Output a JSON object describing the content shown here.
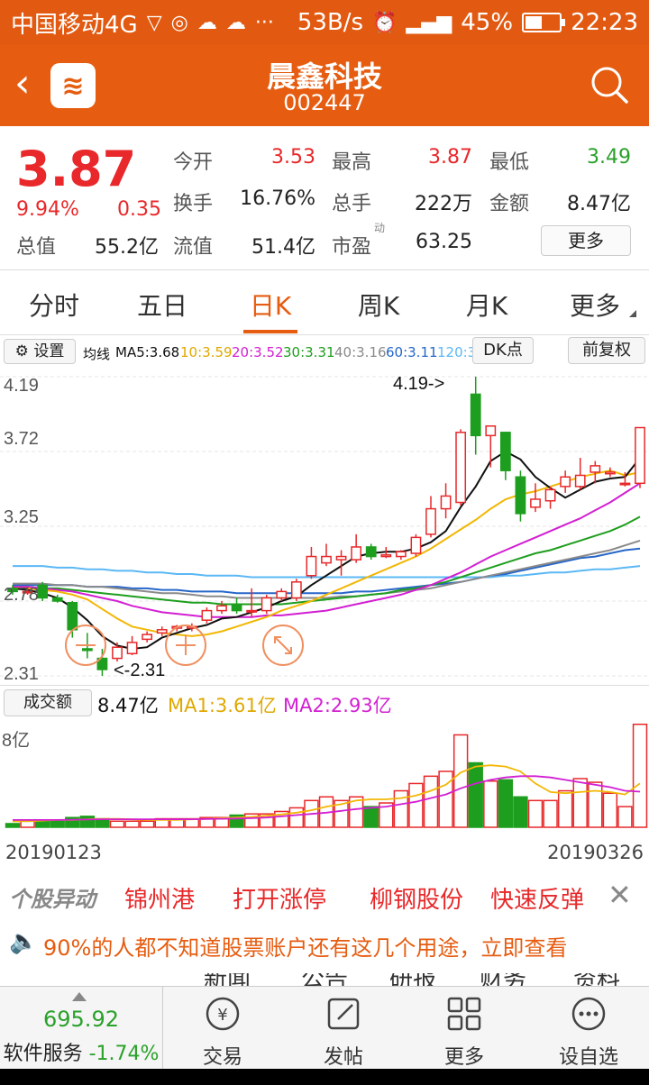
{
  "status_bar": {
    "carrier": "中国移动4G",
    "speed": "53B/s",
    "battery": "45%",
    "time": "22:23"
  },
  "header": {
    "name": "晨鑫科技",
    "code": "002447"
  },
  "quote": {
    "price": "3.87",
    "change_pct": "9.94%",
    "change": "0.35",
    "open_label": "今开",
    "open": "3.53",
    "high_label": "最高",
    "high": "3.87",
    "low_label": "最低",
    "low": "3.49",
    "turnover_label": "换手",
    "turnover": "16.76%",
    "volume_label": "总手",
    "volume": "222万",
    "amount_label": "金额",
    "amount": "8.47亿",
    "mcap_label": "总值",
    "mcap": "55.2亿",
    "float_label": "流值",
    "float": "51.4亿",
    "pe_label": "市盈",
    "pe_sup": "动",
    "pe": "63.25",
    "more": "更多"
  },
  "tabs": [
    "分时",
    "五日",
    "日K",
    "周K",
    "月K",
    "更多"
  ],
  "active_tab": 2,
  "ma_bar": {
    "settings": "设置",
    "label": "均线",
    "ma5": "MA5:3.68",
    "ma10": "10:3.59",
    "ma20": "20:3.52",
    "ma30": "30:3.31",
    "ma40": "40:3.16",
    "ma60": "60:3.11",
    "ma120": "120:3",
    "dk": "DK点",
    "adjust": "前复权"
  },
  "colors": {
    "up": "#e8282a",
    "down": "#1e9e1e",
    "ma5": "#111111",
    "ma10": "#f2b705",
    "ma20": "#d21fd2",
    "ma30": "#1e9e1e",
    "ma40": "#8a8a8a",
    "ma60": "#2767c9",
    "ma120": "#5bb8f5"
  },
  "chart_labels": {
    "y_ticks": [
      "4.19",
      "3.72",
      "3.25",
      "2.78",
      "2.31"
    ],
    "max_marker": "4.19->",
    "min_marker": "<-2.31"
  },
  "volume_bar": {
    "label": "成交额",
    "value": "8.47亿",
    "ma1": "MA1:3.61亿",
    "ma2": "MA2:2.93亿",
    "y_tick": "8亿"
  },
  "dates": {
    "start": "20190123",
    "end": "20190326"
  },
  "news": {
    "logo": "个股异动",
    "items": [
      "锦州港",
      "打开涨停",
      "柳钢股份",
      "快速反弹"
    ]
  },
  "ad": {
    "text": "90%的人都不知道股票账户还有这几个用途，立即查看"
  },
  "subtabs": [
    "新闻",
    "公告",
    "研报",
    "财务",
    "资料"
  ],
  "bottom": {
    "index_value": "695.92",
    "index_name": "软件服务",
    "index_change": "-1.74%",
    "nav": [
      "交易",
      "发帖",
      "更多",
      "设自选"
    ]
  },
  "chart_data": {
    "type": "candlestick",
    "y_range": [
      2.31,
      4.19
    ],
    "x_range": [
      "20190123",
      "20190326"
    ],
    "candles": [
      {
        "o": 2.86,
        "c": 2.84,
        "h": 2.88,
        "l": 2.82
      },
      {
        "o": 2.84,
        "c": 2.84,
        "h": 2.87,
        "l": 2.82
      },
      {
        "o": 2.88,
        "c": 2.8,
        "h": 2.9,
        "l": 2.78
      },
      {
        "o": 2.8,
        "c": 2.78,
        "h": 2.82,
        "l": 2.77
      },
      {
        "o": 2.77,
        "c": 2.6,
        "h": 2.78,
        "l": 2.55
      },
      {
        "o": 2.48,
        "c": 2.47,
        "h": 2.58,
        "l": 2.42
      },
      {
        "o": 2.42,
        "c": 2.35,
        "h": 2.48,
        "l": 2.31
      },
      {
        "o": 2.42,
        "c": 2.49,
        "h": 2.52,
        "l": 2.4
      },
      {
        "o": 2.45,
        "c": 2.52,
        "h": 2.56,
        "l": 2.44
      },
      {
        "o": 2.54,
        "c": 2.57,
        "h": 2.59,
        "l": 2.52
      },
      {
        "o": 2.58,
        "c": 2.6,
        "h": 2.62,
        "l": 2.56
      },
      {
        "o": 2.61,
        "c": 2.62,
        "h": 2.63,
        "l": 2.59
      },
      {
        "o": 2.61,
        "c": 2.62,
        "h": 2.64,
        "l": 2.59
      },
      {
        "o": 2.66,
        "c": 2.72,
        "h": 2.74,
        "l": 2.64
      },
      {
        "o": 2.72,
        "c": 2.75,
        "h": 2.78,
        "l": 2.7
      },
      {
        "o": 2.76,
        "c": 2.72,
        "h": 2.8,
        "l": 2.7
      },
      {
        "o": 2.72,
        "c": 2.72,
        "h": 2.86,
        "l": 2.68
      },
      {
        "o": 2.72,
        "c": 2.8,
        "h": 2.82,
        "l": 2.7
      },
      {
        "o": 2.8,
        "c": 2.84,
        "h": 2.86,
        "l": 2.78
      },
      {
        "o": 2.8,
        "c": 2.9,
        "h": 2.92,
        "l": 2.78
      },
      {
        "o": 2.94,
        "c": 3.06,
        "h": 3.12,
        "l": 2.92
      },
      {
        "o": 3.02,
        "c": 3.06,
        "h": 3.14,
        "l": 3.0
      },
      {
        "o": 3.04,
        "c": 3.06,
        "h": 3.1,
        "l": 2.94
      },
      {
        "o": 3.04,
        "c": 3.12,
        "h": 3.2,
        "l": 3.02
      },
      {
        "o": 3.12,
        "c": 3.06,
        "h": 3.14,
        "l": 3.04
      },
      {
        "o": 3.06,
        "c": 3.07,
        "h": 3.12,
        "l": 3.05
      },
      {
        "o": 3.06,
        "c": 3.09,
        "h": 3.1,
        "l": 3.04
      },
      {
        "o": 3.08,
        "c": 3.18,
        "h": 3.2,
        "l": 3.06
      },
      {
        "o": 3.2,
        "c": 3.36,
        "h": 3.44,
        "l": 3.18
      },
      {
        "o": 3.36,
        "c": 3.44,
        "h": 3.52,
        "l": 3.3
      },
      {
        "o": 3.4,
        "c": 3.84,
        "h": 3.86,
        "l": 3.38
      },
      {
        "o": 4.08,
        "c": 3.82,
        "h": 4.19,
        "l": 3.7
      },
      {
        "o": 3.82,
        "c": 3.88,
        "h": 3.86,
        "l": 3.62
      },
      {
        "o": 3.84,
        "c": 3.6,
        "h": 3.84,
        "l": 3.54
      },
      {
        "o": 3.56,
        "c": 3.33,
        "h": 3.6,
        "l": 3.28
      },
      {
        "o": 3.37,
        "c": 3.42,
        "h": 3.52,
        "l": 3.34
      },
      {
        "o": 3.41,
        "c": 3.48,
        "h": 3.5,
        "l": 3.36
      },
      {
        "o": 3.5,
        "c": 3.56,
        "h": 3.6,
        "l": 3.46
      },
      {
        "o": 3.5,
        "c": 3.57,
        "h": 3.68,
        "l": 3.48
      },
      {
        "o": 3.59,
        "c": 3.63,
        "h": 3.66,
        "l": 3.52
      },
      {
        "o": 3.58,
        "c": 3.59,
        "h": 3.62,
        "l": 3.56
      },
      {
        "o": 3.52,
        "c": 3.52,
        "h": 3.59,
        "l": 3.5
      },
      {
        "o": 3.52,
        "c": 3.87,
        "h": 3.87,
        "l": 3.49
      }
    ],
    "ma_series": {
      "ma5": [
        2.86,
        2.85,
        2.83,
        2.8,
        2.74,
        2.66,
        2.56,
        2.5,
        2.48,
        2.49,
        2.55,
        2.58,
        2.61,
        2.63,
        2.67,
        2.68,
        2.71,
        2.74,
        2.78,
        2.81,
        2.88,
        2.94,
        3.0,
        3.06,
        3.08,
        3.09,
        3.09,
        3.11,
        3.15,
        3.22,
        3.37,
        3.5,
        3.66,
        3.72,
        3.67,
        3.56,
        3.49,
        3.43,
        3.48,
        3.53,
        3.55,
        3.56,
        3.68
      ],
      "ma10": [
        2.86,
        2.86,
        2.85,
        2.84,
        2.82,
        2.79,
        2.73,
        2.67,
        2.62,
        2.6,
        2.58,
        2.57,
        2.56,
        2.57,
        2.59,
        2.62,
        2.65,
        2.68,
        2.72,
        2.75,
        2.78,
        2.82,
        2.86,
        2.9,
        2.94,
        2.98,
        3.02,
        3.06,
        3.11,
        3.17,
        3.23,
        3.29,
        3.36,
        3.42,
        3.45,
        3.47,
        3.5,
        3.53,
        3.56,
        3.58,
        3.6,
        3.57,
        3.59
      ],
      "ma20": [
        2.87,
        2.87,
        2.86,
        2.85,
        2.84,
        2.82,
        2.8,
        2.78,
        2.75,
        2.73,
        2.71,
        2.7,
        2.69,
        2.68,
        2.68,
        2.68,
        2.68,
        2.69,
        2.69,
        2.7,
        2.71,
        2.72,
        2.74,
        2.76,
        2.78,
        2.8,
        2.82,
        2.85,
        2.88,
        2.92,
        2.96,
        3.01,
        3.06,
        3.1,
        3.14,
        3.18,
        3.22,
        3.26,
        3.3,
        3.35,
        3.4,
        3.46,
        3.52
      ],
      "ma30": [
        2.87,
        2.87,
        2.86,
        2.86,
        2.85,
        2.84,
        2.83,
        2.82,
        2.81,
        2.8,
        2.79,
        2.78,
        2.77,
        2.77,
        2.76,
        2.76,
        2.76,
        2.76,
        2.76,
        2.77,
        2.78,
        2.79,
        2.8,
        2.81,
        2.82,
        2.83,
        2.85,
        2.86,
        2.88,
        2.9,
        2.93,
        2.96,
        2.99,
        3.02,
        3.05,
        3.08,
        3.1,
        3.13,
        3.16,
        3.19,
        3.22,
        3.26,
        3.31
      ],
      "ma40": [
        2.89,
        2.89,
        2.89,
        2.88,
        2.88,
        2.87,
        2.87,
        2.86,
        2.85,
        2.84,
        2.83,
        2.83,
        2.82,
        2.81,
        2.81,
        2.8,
        2.8,
        2.8,
        2.8,
        2.8,
        2.8,
        2.8,
        2.81,
        2.81,
        2.82,
        2.83,
        2.84,
        2.85,
        2.86,
        2.88,
        2.9,
        2.92,
        2.94,
        2.96,
        2.98,
        3.0,
        3.02,
        3.04,
        3.06,
        3.08,
        3.1,
        3.13,
        3.16
      ],
      "ma60": [
        2.88,
        2.88,
        2.88,
        2.88,
        2.88,
        2.87,
        2.87,
        2.87,
        2.86,
        2.86,
        2.85,
        2.85,
        2.84,
        2.84,
        2.84,
        2.83,
        2.83,
        2.83,
        2.83,
        2.83,
        2.83,
        2.83,
        2.83,
        2.84,
        2.84,
        2.85,
        2.86,
        2.87,
        2.88,
        2.89,
        2.9,
        2.92,
        2.94,
        2.95,
        2.97,
        2.99,
        3.01,
        3.03,
        3.05,
        3.06,
        3.08,
        3.1,
        3.11
      ],
      "ma120": [
        3.0,
        3.0,
        3.0,
        2.99,
        2.99,
        2.98,
        2.98,
        2.97,
        2.97,
        2.96,
        2.96,
        2.95,
        2.95,
        2.94,
        2.94,
        2.94,
        2.93,
        2.93,
        2.93,
        2.93,
        2.93,
        2.93,
        2.93,
        2.93,
        2.93,
        2.93,
        2.93,
        2.93,
        2.93,
        2.93,
        2.93,
        2.93,
        2.93,
        2.94,
        2.94,
        2.95,
        2.96,
        2.96,
        2.97,
        2.98,
        2.98,
        2.99,
        3.0
      ]
    },
    "volume": {
      "unit": "亿",
      "y_max": 8,
      "values": [
        0.3,
        0.5,
        0.6,
        0.6,
        0.8,
        0.9,
        0.7,
        0.5,
        0.5,
        0.5,
        0.7,
        0.7,
        0.7,
        0.8,
        0.8,
        1.0,
        1.1,
        1.1,
        1.3,
        1.6,
        2.2,
        2.5,
        2.2,
        2.5,
        1.7,
        2.0,
        3.0,
        3.6,
        4.2,
        4.6,
        7.6,
        5.3,
        3.8,
        3.9,
        2.5,
        2.2,
        2.2,
        3.0,
        4.0,
        3.7,
        2.8,
        1.7,
        8.47
      ],
      "ma1": [
        0.5,
        0.5,
        0.55,
        0.6,
        0.6,
        0.65,
        0.7,
        0.7,
        0.65,
        0.6,
        0.6,
        0.6,
        0.65,
        0.7,
        0.75,
        0.8,
        0.85,
        0.95,
        1.05,
        1.2,
        1.4,
        1.7,
        1.9,
        2.2,
        2.3,
        2.3,
        2.4,
        2.6,
        3.0,
        3.5,
        4.5,
        5.0,
        5.1,
        5.0,
        4.6,
        3.6,
        2.9,
        2.8,
        2.9,
        3.0,
        2.9,
        2.7,
        3.61
      ],
      "ma2": [
        0.6,
        0.6,
        0.6,
        0.6,
        0.62,
        0.64,
        0.66,
        0.66,
        0.66,
        0.66,
        0.66,
        0.66,
        0.66,
        0.68,
        0.7,
        0.72,
        0.75,
        0.8,
        0.9,
        1.0,
        1.1,
        1.2,
        1.35,
        1.5,
        1.6,
        1.7,
        1.9,
        2.1,
        2.4,
        2.7,
        3.2,
        3.6,
        3.9,
        4.1,
        4.2,
        4.2,
        4.1,
        3.9,
        3.7,
        3.5,
        3.3,
        3.0,
        2.93
      ]
    }
  }
}
